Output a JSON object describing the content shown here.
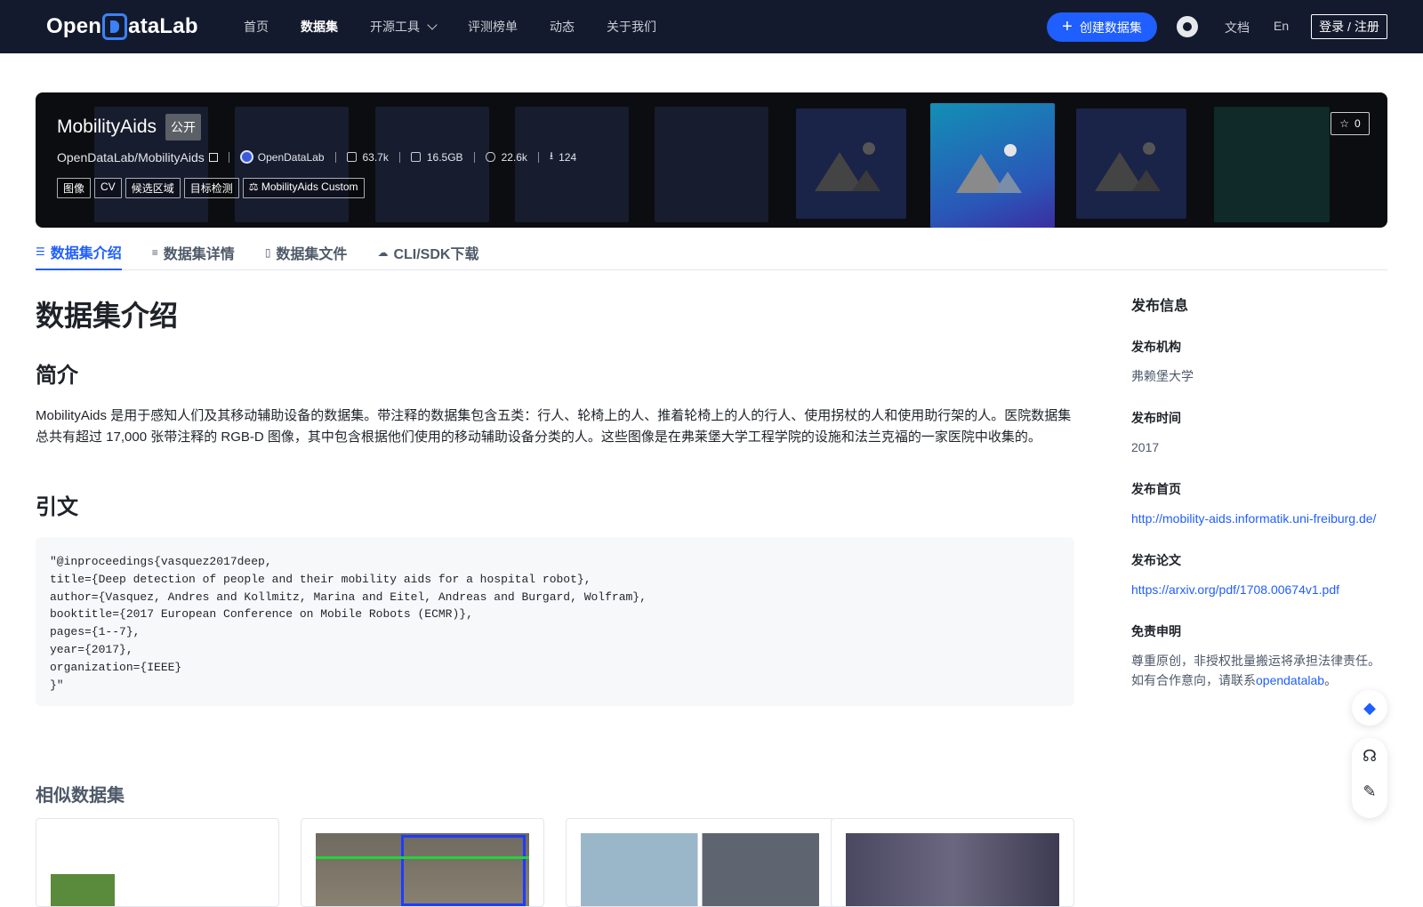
{
  "header": {
    "logo_text_left": "Open",
    "logo_text_right": "ataLab",
    "nav": [
      "首页",
      "数据集",
      "开源工具",
      "评测榜单",
      "动态",
      "关于我们"
    ],
    "create_button": "创建数据集",
    "docs": "文档",
    "lang": "En",
    "login": "登录 / 注册"
  },
  "dataset": {
    "name": "MobilityAids",
    "visibility": "公开",
    "path": "OpenDataLab/MobilityAids",
    "org": "OpenDataLab",
    "stats": {
      "views_icon_count": "63.7k",
      "size": "16.5GB",
      "visits": "22.6k",
      "downloads": "124"
    },
    "tags": [
      "图像",
      "CV",
      "候选区域",
      "目标检测"
    ],
    "license": "MobilityAids Custom",
    "stars": "0"
  },
  "tabs": [
    "数据集介绍",
    "数据集详情",
    "数据集文件",
    "CLI/SDK下载"
  ],
  "content": {
    "title": "数据集介绍",
    "intro_heading": "简介",
    "intro_text": "MobilityAids 是用于感知人们及其移动辅助设备的数据集。带注释的数据集包含五类：行人、轮椅上的人、推着轮椅上的人的行人、使用拐杖的人和使用助行架的人。医院数据集总共有超过 17,000 张带注释的 RGB-D 图像，其中包含根据他们使用的移动辅助设备分类的人。这些图像是在弗莱堡大学工程学院的设施和法兰克福的一家医院中收集的。",
    "citation_heading": "引文",
    "citation": "\"@inproceedings{vasquez2017deep,\ntitle={Deep detection of people and their mobility aids for a hospital robot},\nauthor={Vasquez, Andres and Kollmitz, Marina and Eitel, Andreas and Burgard, Wolfram},\nbooktitle={2017 European Conference on Mobile Robots (ECMR)},\npages={1--7},\nyear={2017},\norganization={IEEE}\n}\"",
    "similar_heading": "相似数据集"
  },
  "sidebar": {
    "title": "发布信息",
    "org_label": "发布机构",
    "org_value": "弗赖堡大学",
    "time_label": "发布时间",
    "time_value": "2017",
    "home_label": "发布首页",
    "home_value": "http://mobility-aids.informatik.uni-freiburg.de/",
    "paper_label": "发布论文",
    "paper_value": "https://arxiv.org/pdf/1708.00674v1.pdf",
    "disclaimer_label": "免责申明",
    "disclaimer_line1": "尊重原创，非授权批量搬运将承担法律责任。",
    "disclaimer_line2_prefix": "如有合作意向，请联系",
    "disclaimer_link": "opendatalab",
    "disclaimer_suffix": "。"
  },
  "colors": {
    "accent": "#1f5eff",
    "topbar": "#141a2e"
  }
}
